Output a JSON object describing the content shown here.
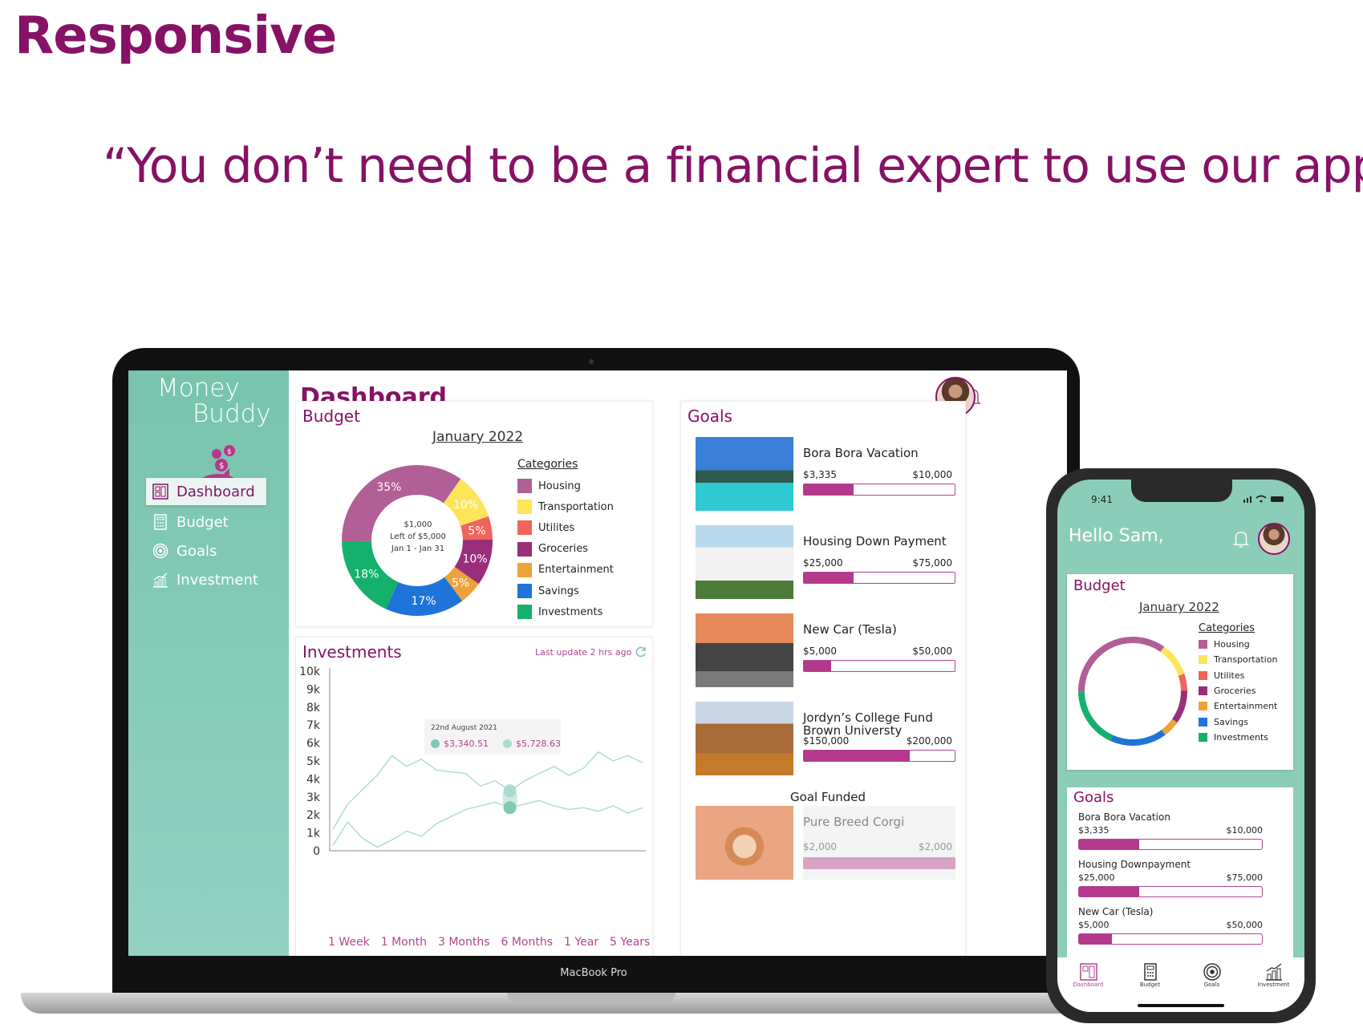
{
  "heading": "Responsive",
  "quote": "“You don’t need to be a financial expert to use our app.”",
  "laptop_label": "MacBook Pro",
  "app": {
    "logo_line1": "Money",
    "logo_line2": "Buddy",
    "nav": [
      "Dashboard",
      "Budget",
      "Goals",
      "Investment"
    ],
    "page_title": "Dashboard"
  },
  "budget": {
    "title": "Budget",
    "period": "January 2022",
    "center_amount": "$1,000",
    "center_left": "Left of $5,000",
    "center_range": "Jan 1 - Jan 31",
    "categories_label": "Categories",
    "categories": [
      {
        "name": "Housing",
        "color": "#b15f96",
        "pct": 35
      },
      {
        "name": "Transportation",
        "color": "#fde55a",
        "pct": 10
      },
      {
        "name": "Utilites",
        "color": "#f0645a",
        "pct": 5
      },
      {
        "name": "Groceries",
        "color": "#992e7a",
        "pct": 10
      },
      {
        "name": "Entertainment",
        "color": "#eea23a",
        "pct": 5
      },
      {
        "name": "Savings",
        "color": "#1e74d8",
        "pct": 17
      },
      {
        "name": "Investments",
        "color": "#14b16c",
        "pct": 18
      }
    ],
    "slice_labels": [
      "35%",
      "10%",
      "5%",
      "10%",
      "5%",
      "17%",
      "18%"
    ]
  },
  "investments": {
    "title": "Investments",
    "last_update": "Last update 2 hrs ago",
    "tooltip_date": "22nd August 2021",
    "tooltip_v1": "$3,340.51",
    "tooltip_v2": "$5,728.63",
    "ranges": [
      "1 Week",
      "1 Month",
      "3 Months",
      "6 Months",
      "1 Year",
      "5 Years"
    ],
    "colors": {
      "series1": "#a9dcd0",
      "series2": "#a9dcd0"
    }
  },
  "chart_data": {
    "type": "line",
    "yticks": [
      "10k",
      "9k",
      "8k",
      "7k",
      "6k",
      "5k",
      "4k",
      "3k",
      "2k",
      "1k",
      "0"
    ],
    "ylim": [
      0,
      10000
    ],
    "series": [
      {
        "values": [
          1200,
          2600,
          3400,
          4200,
          5300,
          4700,
          5100,
          4500,
          4400,
          4300,
          3600,
          3900,
          3340,
          3900,
          4300,
          4700,
          4200,
          4600,
          5500,
          5000,
          5300,
          4900
        ]
      },
      {
        "values": [
          300,
          1600,
          700,
          200,
          600,
          1100,
          800,
          1500,
          1900,
          2300,
          2500,
          2700,
          2400,
          2600,
          2800,
          2500,
          2300,
          2400,
          2200,
          2500,
          2100,
          2400
        ]
      }
    ]
  },
  "goals": {
    "title": "Goals",
    "items": [
      {
        "name": "Bora Bora Vacation",
        "current": "$3,335",
        "target": "$10,000",
        "progress": 0.33
      },
      {
        "name": "Housing Down Payment",
        "current": "$25,000",
        "target": "$75,000",
        "progress": 0.33
      },
      {
        "name": "New Car (Tesla)",
        "current": "$5,000",
        "target": "$50,000",
        "progress": 0.18
      },
      {
        "name": "Jordyn’s College Fund\nBrown Universty",
        "current": "$150,000",
        "target": "$200,000",
        "progress": 0.7
      }
    ],
    "funded_label": "Goal Funded",
    "funded": {
      "name": "Pure Breed Corgi",
      "current": "$2,000",
      "target": "$2,000",
      "progress": 1
    }
  },
  "phone": {
    "time": "9:41",
    "greeting": "Hello Sam,",
    "budget_title": "Budget",
    "period": "January 2022",
    "categories_label": "Categories",
    "goals_title": "Goals",
    "goals": [
      {
        "name": "Bora Bora Vacation",
        "current": "$3,335",
        "target": "$10,000",
        "progress": 0.33
      },
      {
        "name": "Housing Downpayment",
        "current": "$25,000",
        "target": "$75,000",
        "progress": 0.33
      },
      {
        "name": "New Car (Tesla)",
        "current": "$5,000",
        "target": "$50,000",
        "progress": 0.18
      }
    ],
    "tabs": [
      "Dashboard",
      "Budget",
      "Goals",
      "Investment"
    ]
  }
}
